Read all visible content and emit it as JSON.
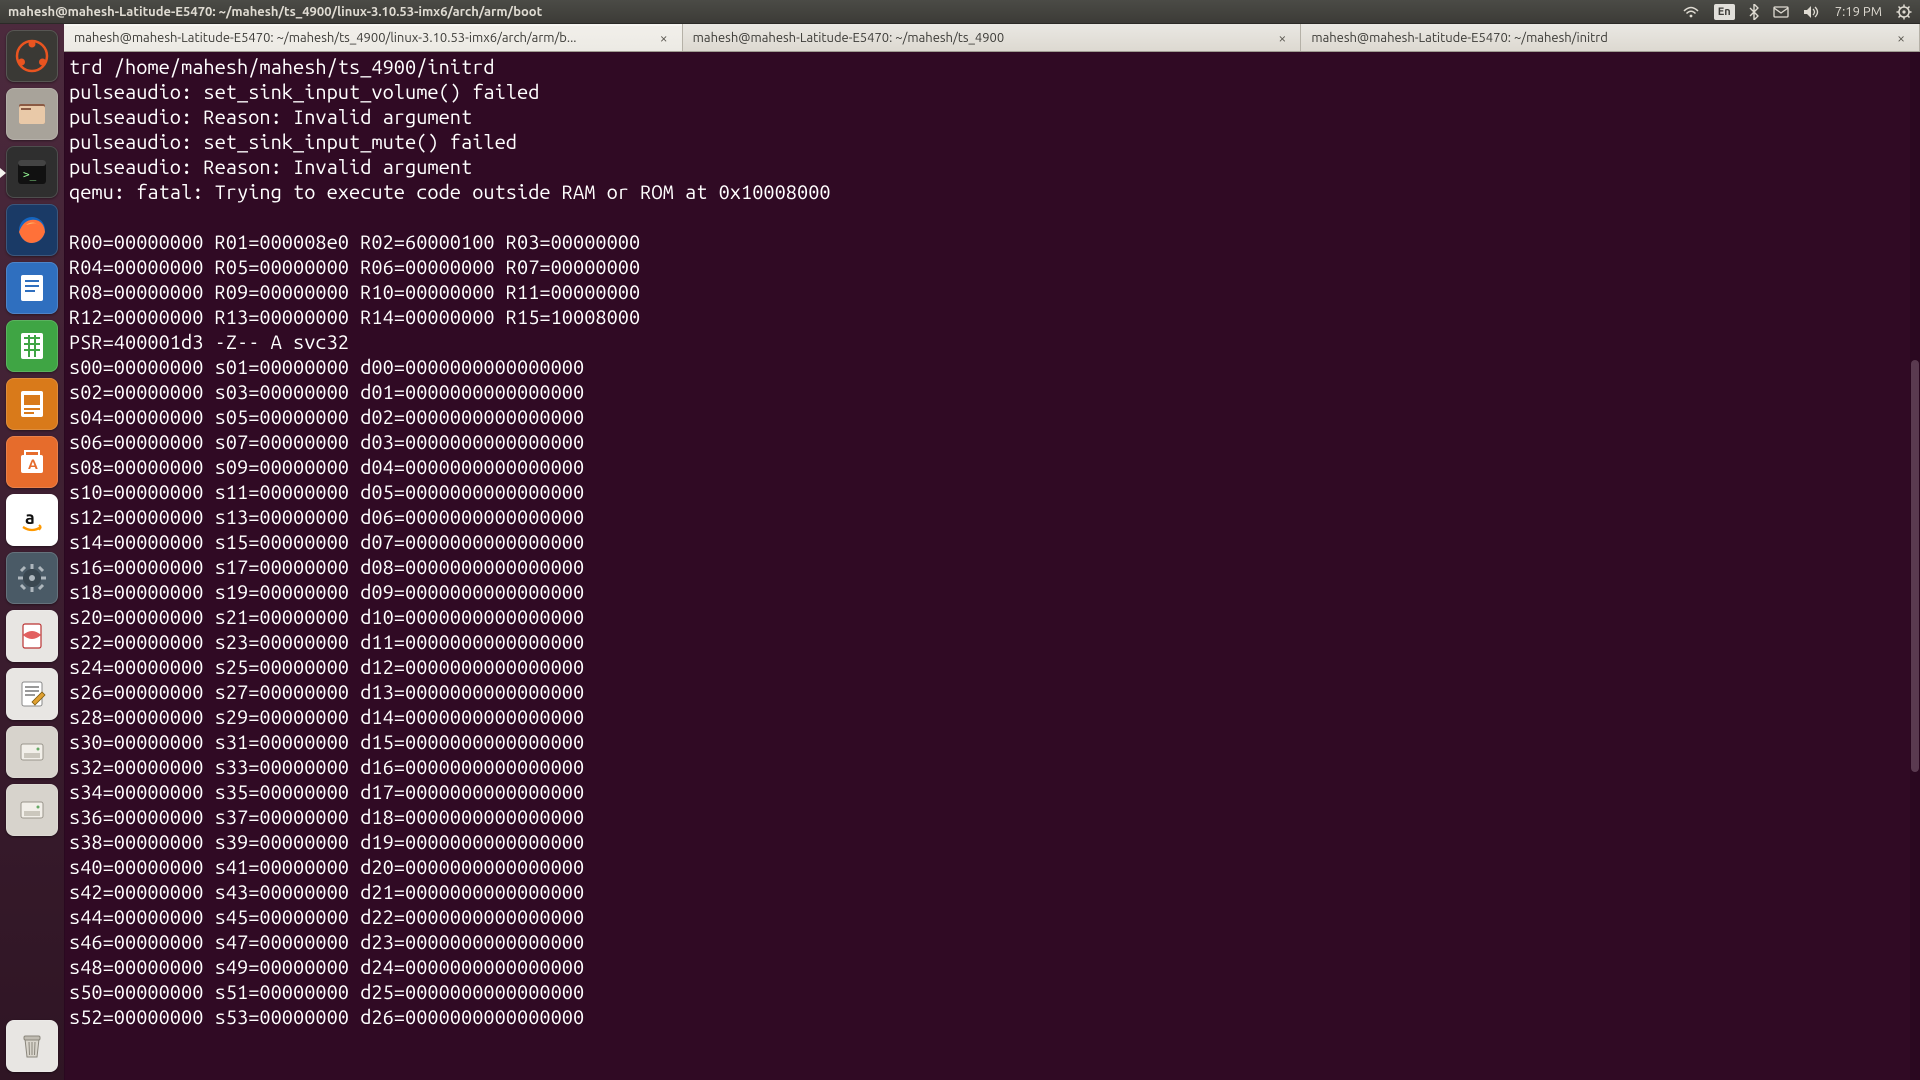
{
  "menubar": {
    "title": "mahesh@mahesh-Latitude-E5470: ~/mahesh/ts_4900/linux-3.10.53-imx6/arch/arm/boot",
    "lang": "En",
    "time": "7:19 PM"
  },
  "tabs": [
    {
      "label": "mahesh@mahesh-Latitude-E5470: ~/mahesh/ts_4900/linux-3.10.53-imx6/arch/arm/b...",
      "active": true
    },
    {
      "label": "mahesh@mahesh-Latitude-E5470: ~/mahesh/ts_4900",
      "active": false
    },
    {
      "label": "mahesh@mahesh-Latitude-E5470: ~/mahesh/initrd",
      "active": false
    }
  ],
  "launcher": {
    "items": [
      {
        "name": "dash-icon"
      },
      {
        "name": "files-icon"
      },
      {
        "name": "terminal-icon",
        "running": true
      },
      {
        "name": "firefox-icon"
      },
      {
        "name": "writer-icon"
      },
      {
        "name": "calc-icon"
      },
      {
        "name": "impress-icon"
      },
      {
        "name": "software-center-icon"
      },
      {
        "name": "amazon-icon"
      },
      {
        "name": "system-settings-icon"
      },
      {
        "name": "document-viewer-icon"
      },
      {
        "name": "text-editor-icon"
      },
      {
        "name": "disk1-icon"
      },
      {
        "name": "disk2-icon"
      }
    ],
    "trash": {
      "name": "trash-icon"
    }
  },
  "terminal": {
    "lines": [
      "trd /home/mahesh/mahesh/ts_4900/initrd",
      "pulseaudio: set_sink_input_volume() failed",
      "pulseaudio: Reason: Invalid argument",
      "pulseaudio: set_sink_input_mute() failed",
      "pulseaudio: Reason: Invalid argument",
      "qemu: fatal: Trying to execute code outside RAM or ROM at 0x10008000",
      "",
      "R00=00000000 R01=000008e0 R02=60000100 R03=00000000",
      "R04=00000000 R05=00000000 R06=00000000 R07=00000000",
      "R08=00000000 R09=00000000 R10=00000000 R11=00000000",
      "R12=00000000 R13=00000000 R14=00000000 R15=10008000",
      "PSR=400001d3 -Z-- A svc32",
      "s00=00000000 s01=00000000 d00=0000000000000000",
      "s02=00000000 s03=00000000 d01=0000000000000000",
      "s04=00000000 s05=00000000 d02=0000000000000000",
      "s06=00000000 s07=00000000 d03=0000000000000000",
      "s08=00000000 s09=00000000 d04=0000000000000000",
      "s10=00000000 s11=00000000 d05=0000000000000000",
      "s12=00000000 s13=00000000 d06=0000000000000000",
      "s14=00000000 s15=00000000 d07=0000000000000000",
      "s16=00000000 s17=00000000 d08=0000000000000000",
      "s18=00000000 s19=00000000 d09=0000000000000000",
      "s20=00000000 s21=00000000 d10=0000000000000000",
      "s22=00000000 s23=00000000 d11=0000000000000000",
      "s24=00000000 s25=00000000 d12=0000000000000000",
      "s26=00000000 s27=00000000 d13=0000000000000000",
      "s28=00000000 s29=00000000 d14=0000000000000000",
      "s30=00000000 s31=00000000 d15=0000000000000000",
      "s32=00000000 s33=00000000 d16=0000000000000000",
      "s34=00000000 s35=00000000 d17=0000000000000000",
      "s36=00000000 s37=00000000 d18=0000000000000000",
      "s38=00000000 s39=00000000 d19=0000000000000000",
      "s40=00000000 s41=00000000 d20=0000000000000000",
      "s42=00000000 s43=00000000 d21=0000000000000000",
      "s44=00000000 s45=00000000 d22=0000000000000000",
      "s46=00000000 s47=00000000 d23=0000000000000000",
      "s48=00000000 s49=00000000 d24=0000000000000000",
      "s50=00000000 s51=00000000 d25=0000000000000000",
      "s52=00000000 s53=00000000 d26=0000000000000000"
    ]
  }
}
